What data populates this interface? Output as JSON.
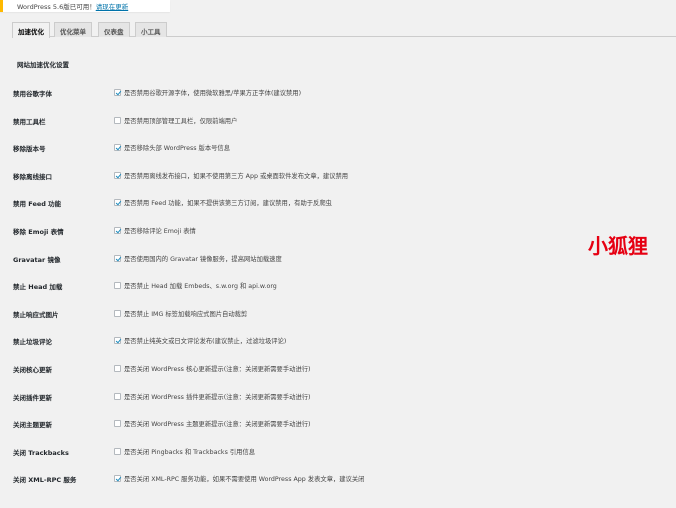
{
  "notice": {
    "text": "WordPress 5.6版已可用！",
    "link": "请现在更新"
  },
  "tabs": [
    {
      "label": "加速优化",
      "active": true
    },
    {
      "label": "优化菜单",
      "active": false
    },
    {
      "label": "仪表盘",
      "active": false
    },
    {
      "label": "小工具",
      "active": false
    }
  ],
  "section_title": "网站加速优化设置",
  "options": [
    {
      "label": "禁用谷歌字体",
      "desc": "是否禁用谷歌开源字体，使用微软雅黑/苹果方正字体(建议禁用)",
      "checked": true
    },
    {
      "label": "禁用工具栏",
      "desc": "是否禁用顶部管理工具栏，仅限前端用户",
      "checked": false
    },
    {
      "label": "移除版本号",
      "desc": "是否移除头部 WordPress 版本号信息",
      "checked": true
    },
    {
      "label": "移除离线接口",
      "desc": "是否禁用离线发布接口，如果不使用第三方 App 或桌面软件发布文章，建议禁用",
      "checked": true
    },
    {
      "label": "禁用 Feed 功能",
      "desc": "是否禁用 Feed 功能，如果不提供该第三方订阅，建议禁用，有助于反爬虫",
      "checked": true
    },
    {
      "label": "移除 Emoji 表情",
      "desc": "是否移除评论 Emoji 表情",
      "checked": true
    },
    {
      "label": "Gravatar 镜像",
      "desc": "是否使用国内的 Gravatar 镜像服务，提高网站加载速度",
      "checked": true
    },
    {
      "label": "禁止 Head 加载",
      "desc": "是否禁止 Head 加载 Embeds、s.w.org 和 api.w.org",
      "checked": false
    },
    {
      "label": "禁止响应式图片",
      "desc": "是否禁止 IMG 标签加载响应式图片自动裁剪",
      "checked": false
    },
    {
      "label": "禁止垃圾评论",
      "desc": "是否禁止纯英文或日文评论发布(建议禁止，过滤垃圾评论)",
      "checked": true
    },
    {
      "label": "关闭核心更新",
      "desc": "是否关闭 WordPress 核心更新提示(注意：关闭更新需要手动进行)",
      "checked": false
    },
    {
      "label": "关闭插件更新",
      "desc": "是否关闭 WordPress 插件更新提示(注意：关闭更新需要手动进行)",
      "checked": false
    },
    {
      "label": "关闭主题更新",
      "desc": "是否关闭 WordPress 主题更新提示(注意：关闭更新需要手动进行)",
      "checked": false
    },
    {
      "label": "关闭 Trackbacks",
      "desc": "是否关闭 Pingbacks 和 Trackbacks 引用信息",
      "checked": false
    },
    {
      "label": "关闭 XML-RPC 服务",
      "desc": "是否关闭 XML-RPC 服务功能，如果不需要使用 WordPress App 发表文章，建议关闭",
      "checked": true
    }
  ],
  "watermark": "小狐狸"
}
